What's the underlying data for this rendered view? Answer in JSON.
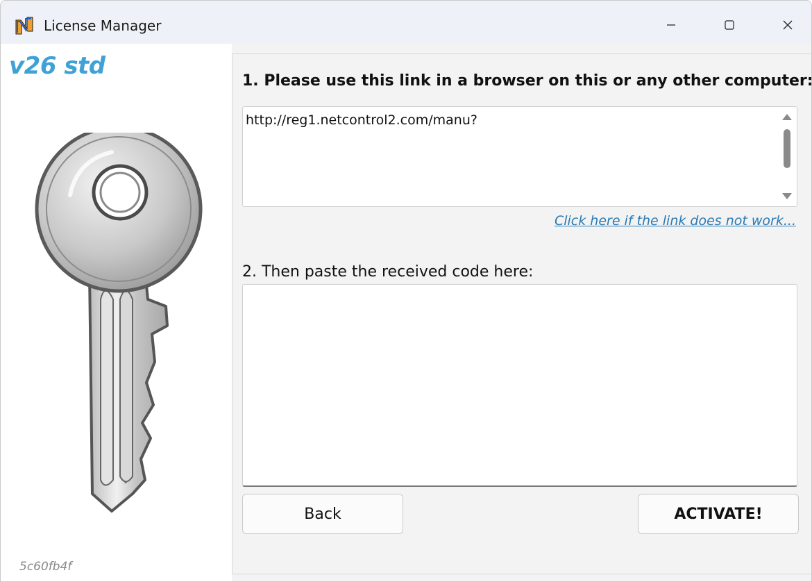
{
  "window": {
    "title": "License Manager",
    "controls": {
      "minimize_icon": "minimize-icon",
      "maximize_icon": "maximize-icon",
      "close_icon": "close-icon"
    }
  },
  "sidebar": {
    "version": "v26 std",
    "hash": "5c60fb4f",
    "version_color": "#3fa2d6"
  },
  "main": {
    "step1_label": "1. Please use this link in a browser on this or any other computer:",
    "link_value": "http://reg1.netcontrol2.com/manu?",
    "help_link": "Click here if the link does not work...",
    "step2_label": "2. Then paste the received code here:",
    "code_value": "",
    "back_label": "Back",
    "activate_label": "ACTIVATE!"
  },
  "colors": {
    "link": "#2a7ab4",
    "accent": "#3fa2d6"
  }
}
